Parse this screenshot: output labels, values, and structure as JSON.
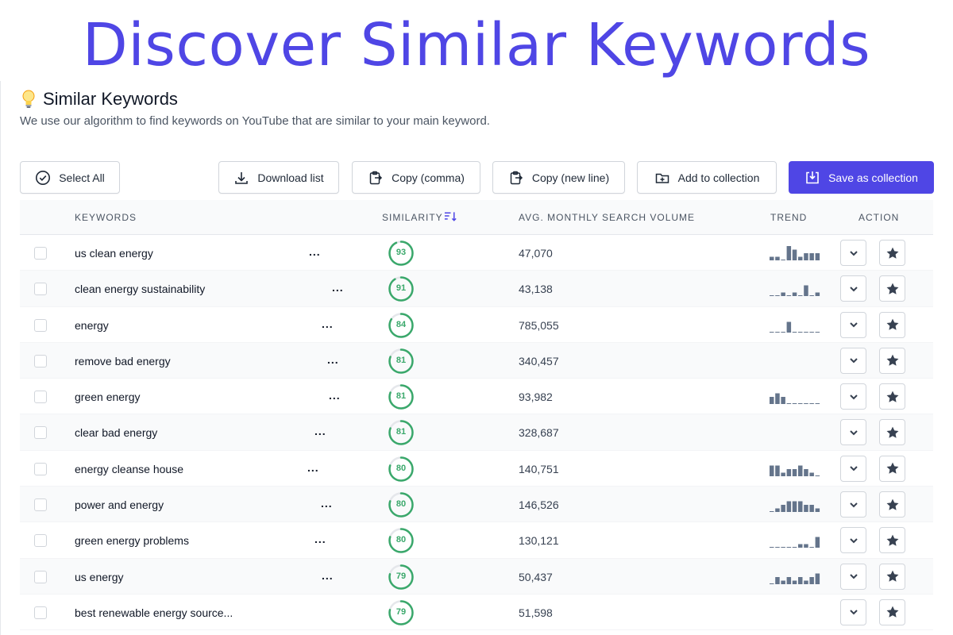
{
  "hero_title": "Discover Similar Keywords",
  "section": {
    "title": "Similar Keywords",
    "subtitle": "We use our algorithm to find keywords on YouTube that are similar to your main keyword.",
    "icon": "lightbulb-icon"
  },
  "toolbar": {
    "select_all": "Select All",
    "download": "Download list",
    "copy_comma": "Copy (comma)",
    "copy_newline": "Copy (new line)",
    "add_collection": "Add to collection",
    "save_collection": "Save as collection"
  },
  "table": {
    "headers": {
      "keywords": "KEYWORDS",
      "similarity": "SIMILARITY",
      "volume": "AVG. MONTHLY SEARCH VOLUME",
      "trend": "TREND",
      "action": "ACTION"
    },
    "rows": [
      {
        "keyword": "us clean energy",
        "similarity": 93,
        "volume": "47,070",
        "trend": [
          1,
          1,
          0,
          4,
          3,
          1,
          2,
          2,
          2
        ],
        "dots": "..."
      },
      {
        "keyword": "clean energy sustainability",
        "similarity": 91,
        "volume": "43,138",
        "trend": [
          0,
          0,
          1,
          0,
          1,
          0,
          3,
          0,
          1
        ],
        "dots": "..."
      },
      {
        "keyword": "energy",
        "similarity": 84,
        "volume": "785,055",
        "trend": [
          0,
          0,
          0,
          3,
          0,
          0,
          0,
          0,
          0
        ],
        "dots": "..."
      },
      {
        "keyword": "remove bad energy",
        "similarity": 81,
        "volume": "340,457",
        "trend": [],
        "dots": "..."
      },
      {
        "keyword": "green energy",
        "similarity": 81,
        "volume": "93,982",
        "trend": [
          2,
          3,
          2,
          0,
          0,
          0,
          0,
          0,
          0
        ],
        "dots": "..."
      },
      {
        "keyword": "clear bad energy",
        "similarity": 81,
        "volume": "328,687",
        "trend": [],
        "dots": "..."
      },
      {
        "keyword": "energy cleanse house",
        "similarity": 80,
        "volume": "140,751",
        "trend": [
          3,
          3,
          1,
          2,
          2,
          3,
          2,
          1,
          0
        ],
        "dots": "..."
      },
      {
        "keyword": "power and energy",
        "similarity": 80,
        "volume": "146,526",
        "trend": [
          0,
          1,
          2,
          3,
          3,
          3,
          2,
          2,
          1
        ],
        "dots": "..."
      },
      {
        "keyword": "green energy problems",
        "similarity": 80,
        "volume": "130,121",
        "trend": [
          0,
          0,
          0,
          0,
          0,
          1,
          1,
          0,
          3
        ],
        "dots": "..."
      },
      {
        "keyword": "us energy",
        "similarity": 79,
        "volume": "50,437",
        "trend": [
          0,
          2,
          1,
          2,
          1,
          2,
          1,
          2,
          3
        ],
        "dots": "..."
      },
      {
        "keyword": "best renewable energy source...",
        "similarity": 79,
        "volume": "51,598",
        "trend": [],
        "dots": ""
      }
    ]
  },
  "colors": {
    "accent": "#4f46e5",
    "similarity_green": "#3aa86b",
    "trend_bar": "#64748b"
  }
}
